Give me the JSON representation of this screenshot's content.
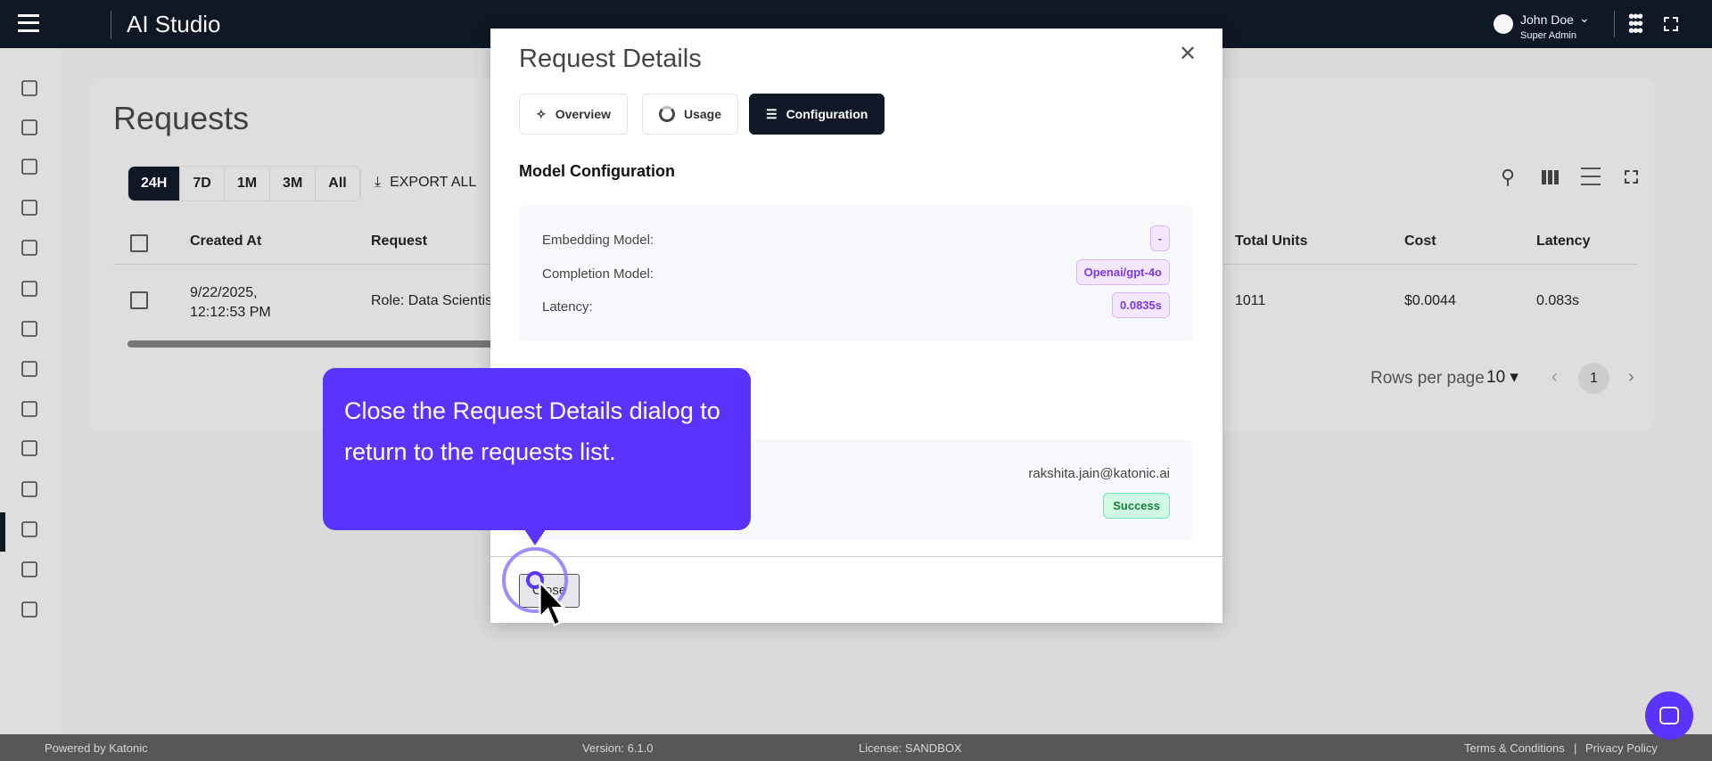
{
  "topbar": {
    "title": "AI Studio",
    "user_name": "John Doe",
    "user_role": "Super Admin"
  },
  "sidebar": {
    "icons": [
      "dashboard-icon",
      "chip-icon",
      "graduation-icon",
      "briefcase-icon",
      "toolbox-icon",
      "video-settings-icon",
      "brain-icon",
      "monitor-icon",
      "link-app-icon",
      "sliders-icon",
      "user-settings-icon",
      "laptop-search-icon",
      "store-icon",
      "admin-settings-icon"
    ],
    "active_index": 11
  },
  "page": {
    "title": "Requests",
    "filters": [
      "24H",
      "7D",
      "1M",
      "3M",
      "All"
    ],
    "active_filter": "24H",
    "export_label": "EXPORT ALL"
  },
  "table": {
    "columns": [
      "Created At",
      "Request",
      "Total Units",
      "Cost",
      "Latency"
    ],
    "rows": [
      {
        "created_at": "9/22/2025, 12:12:53 PM",
        "request": "Role: Data Scientist",
        "total_units": "1011",
        "cost": "$0.0044",
        "latency": "0.083s"
      }
    ]
  },
  "pagination": {
    "rows_per_page_label": "Rows per page",
    "rows_per_page": "10",
    "current_page": "1"
  },
  "dialog": {
    "title": "Request Details",
    "tabs": [
      "Overview",
      "Usage",
      "Configuration"
    ],
    "active_tab": "Configuration",
    "section_title": "Model Configuration",
    "config": [
      {
        "label": "Embedding Model:",
        "value": "-"
      },
      {
        "label": "Completion Model:",
        "value": "Openai/gpt-4o"
      },
      {
        "label": "Latency:",
        "value": "0.0835s"
      }
    ],
    "user_email": "rakshita.jain@katonic.ai",
    "status": "Success",
    "close_label": "Close"
  },
  "tooltip": {
    "text": "Close the Request Details dialog to return to the requests list."
  },
  "footer": {
    "powered": "Powered by Katonic",
    "version": "Version: 6.1.0",
    "license": "License: SANDBOX",
    "terms": "Terms & Conditions",
    "separator": "|",
    "privacy": "Privacy Policy"
  },
  "colors": {
    "dark": "#111827",
    "accent": "#5b33ff",
    "pill": "#7c3aed",
    "success": "#15803d"
  }
}
